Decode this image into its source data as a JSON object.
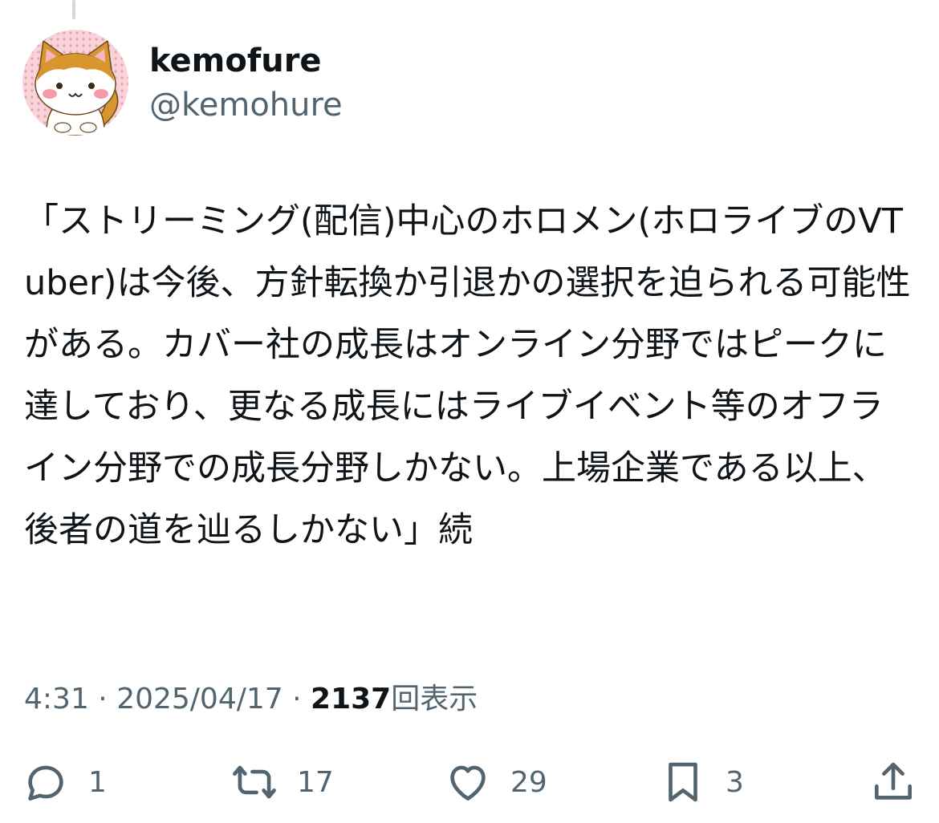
{
  "author": {
    "display_name": "kemofure",
    "handle": "@kemohure"
  },
  "tweet": {
    "text": "「ストリーミング(配信)中心のホロメン(ホロライブのVTuber)は今後、方針転換か引退かの選択を迫られる可能性がある。カバー社の成長はオンライン分野ではピークに達しており、更なる成長にはライブイベント等のオフライン分野での成長分野しかない。上場企業である以上、後者の道を辿るしかない」続"
  },
  "meta": {
    "time": "4:31",
    "separator_1": " · ",
    "date": "2025/04/17",
    "separator_2": " · ",
    "views_count": "2137",
    "views_label": "回表示"
  },
  "actions": {
    "reply_count": "1",
    "retweet_count": "17",
    "like_count": "29",
    "bookmark_count": "3",
    "icons": [
      "reply-icon",
      "retweet-icon",
      "like-icon",
      "bookmark-icon",
      "share-icon"
    ]
  },
  "colors": {
    "text_primary": "#0f1419",
    "text_secondary": "#536471",
    "avatar_bg": "#f7c7cf",
    "cat_orange": "#d9962f"
  }
}
